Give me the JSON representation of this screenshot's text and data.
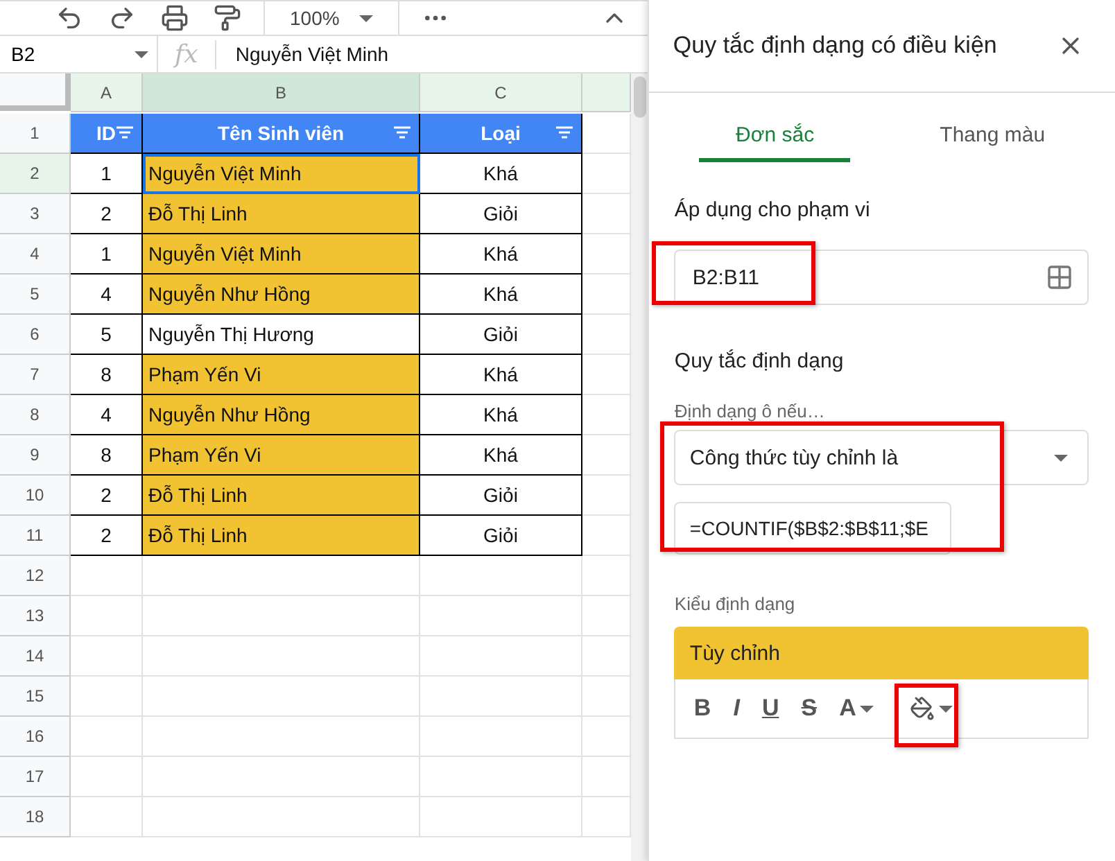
{
  "toolbar": {
    "zoom": "100%"
  },
  "formula_bar": {
    "cell_ref": "B2",
    "fx": "fx",
    "value": "Nguyễn Việt Minh"
  },
  "sheet": {
    "columns": [
      "A",
      "B",
      "C"
    ],
    "header": [
      {
        "label": "ID"
      },
      {
        "label": "Tên Sinh viên"
      },
      {
        "label": "Loại"
      }
    ],
    "rows": [
      {
        "num": "1",
        "cells": null
      },
      {
        "num": "2",
        "id": "1",
        "name": "Nguyễn Việt Minh",
        "type": "Khá",
        "highlighted": true,
        "selected": true
      },
      {
        "num": "3",
        "id": "2",
        "name": "Đỗ Thị Linh",
        "type": "Giỏi",
        "highlighted": true,
        "selected": false
      },
      {
        "num": "4",
        "id": "1",
        "name": "Nguyễn Việt Minh",
        "type": "Khá",
        "highlighted": true,
        "selected": false
      },
      {
        "num": "5",
        "id": "4",
        "name": "Nguyễn Như Hồng",
        "type": "Khá",
        "highlighted": true,
        "selected": false
      },
      {
        "num": "6",
        "id": "5",
        "name": "Nguyễn Thị Hương",
        "type": "Giỏi",
        "highlighted": false,
        "selected": false
      },
      {
        "num": "7",
        "id": "8",
        "name": "Phạm Yến Vi",
        "type": "Khá",
        "highlighted": true,
        "selected": false
      },
      {
        "num": "8",
        "id": "4",
        "name": "Nguyễn Như Hồng",
        "type": "Khá",
        "highlighted": true,
        "selected": false
      },
      {
        "num": "9",
        "id": "8",
        "name": "Phạm Yến Vi",
        "type": "Khá",
        "highlighted": true,
        "selected": false
      },
      {
        "num": "10",
        "id": "2",
        "name": "Đỗ Thị Linh",
        "type": "Giỏi",
        "highlighted": true,
        "selected": false
      },
      {
        "num": "11",
        "id": "2",
        "name": "Đỗ Thị Linh",
        "type": "Giỏi",
        "highlighted": true,
        "selected": false
      }
    ],
    "empty_rows": [
      "12",
      "13",
      "14",
      "15",
      "16",
      "17",
      "18"
    ]
  },
  "panel": {
    "title": "Quy tắc định dạng có điều kiện",
    "tabs": [
      {
        "label": "Đơn sắc",
        "selected": true
      },
      {
        "label": "Thang màu",
        "selected": false
      }
    ],
    "range_label": "Áp dụng cho phạm vi",
    "range_value": "B2:B11",
    "range_annotated": true,
    "rules_label": "Quy tắc định dạng",
    "condition_label": "Định dạng ô nếu…",
    "condition": "Công thức tùy chỉnh là",
    "formula": "=COUNTIF($B$2:$B$11;$E",
    "condition_annotated": true,
    "style_label": "Kiểu định dạng",
    "style_preview": "Tùy chỉnh",
    "fill_annotated": true,
    "style_buttons": [
      {
        "kind": "bold",
        "label": "B"
      },
      {
        "kind": "italic",
        "label": "I"
      },
      {
        "kind": "underline",
        "label": "U"
      },
      {
        "kind": "strike",
        "label": "S"
      },
      {
        "kind": "text-color",
        "label": "A"
      },
      {
        "kind": "fill"
      }
    ]
  }
}
